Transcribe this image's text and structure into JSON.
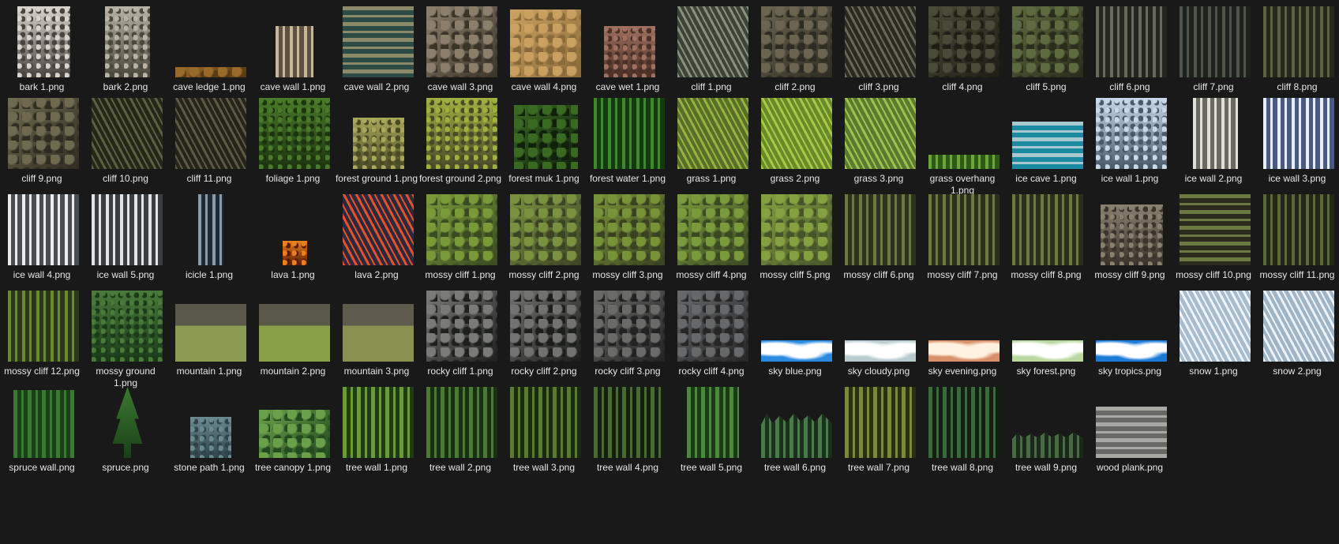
{
  "files": [
    {
      "name": "bark 1.png",
      "w": 0.74,
      "h": 1.0,
      "a": "#d9d4cc",
      "b": "#4a4440",
      "t": "speckle",
      "icon": "rock-texture-icon"
    },
    {
      "name": "bark 2.png",
      "w": 0.63,
      "h": 1.0,
      "a": "#b9b3a6",
      "b": "#4a473c",
      "t": "speckle",
      "icon": "rock-texture-icon"
    },
    {
      "name": "cave ledge 1.png",
      "w": 1.0,
      "h": 0.14,
      "a": "#9a6a2a",
      "b": "#5a3a14",
      "t": "noise",
      "icon": "ledge-texture-icon"
    },
    {
      "name": "cave wall 1.png",
      "w": 0.53,
      "h": 0.72,
      "a": "#c8b69a",
      "b": "#5e5040",
      "t": "vstripe",
      "icon": "rock-texture-icon"
    },
    {
      "name": "cave wall 2.png",
      "w": 1.0,
      "h": 1.0,
      "a": "#8a8a6a",
      "b": "#2c4a46",
      "t": "hstripe",
      "icon": "rock-texture-icon"
    },
    {
      "name": "cave wall 3.png",
      "w": 1.0,
      "h": 1.0,
      "a": "#8b7f6c",
      "b": "#3a3428",
      "t": "noise",
      "icon": "rock-texture-icon"
    },
    {
      "name": "cave wall 4.png",
      "w": 1.0,
      "h": 0.96,
      "a": "#c9a060",
      "b": "#8a6a3a",
      "t": "noise",
      "icon": "rock-texture-icon"
    },
    {
      "name": "cave wet 1.png",
      "w": 0.72,
      "h": 0.72,
      "a": "#a07060",
      "b": "#4a3026",
      "t": "speckle",
      "icon": "rock-texture-icon"
    },
    {
      "name": "cliff 1.png",
      "w": 1.0,
      "h": 1.0,
      "a": "#8a9080",
      "b": "#3c4438",
      "t": "diag",
      "icon": "cliff-texture-icon"
    },
    {
      "name": "cliff 2.png",
      "w": 1.0,
      "h": 1.0,
      "a": "#6a6450",
      "b": "#2e2c22",
      "t": "noise",
      "icon": "cliff-texture-icon"
    },
    {
      "name": "cliff 3.png",
      "w": 1.0,
      "h": 1.0,
      "a": "#6a6858",
      "b": "#2a2a22",
      "t": "diag",
      "icon": "cliff-texture-icon"
    },
    {
      "name": "cliff 4.png",
      "w": 1.0,
      "h": 1.0,
      "a": "#4a4a38",
      "b": "#1e1e16",
      "t": "noise",
      "icon": "cliff-texture-icon"
    },
    {
      "name": "cliff 5.png",
      "w": 1.0,
      "h": 1.0,
      "a": "#5e6a40",
      "b": "#2a2c1c",
      "t": "noise",
      "icon": "cliff-texture-icon"
    },
    {
      "name": "cliff 6.png",
      "w": 1.0,
      "h": 1.0,
      "a": "#6a6a5a",
      "b": "#262620",
      "t": "vstripe",
      "icon": "cliff-texture-icon"
    },
    {
      "name": "cliff 7.png",
      "w": 1.0,
      "h": 1.0,
      "a": "#4e5448",
      "b": "#1e221e",
      "t": "vstripe",
      "icon": "cliff-texture-icon"
    },
    {
      "name": "cliff 8.png",
      "w": 1.0,
      "h": 1.0,
      "a": "#5e6044",
      "b": "#26281c",
      "t": "vstripe",
      "icon": "cliff-texture-icon"
    },
    {
      "name": "cliff 9.png",
      "w": 1.0,
      "h": 1.0,
      "a": "#6e6a50",
      "b": "#302c22",
      "t": "noise",
      "icon": "cliff-texture-icon"
    },
    {
      "name": "cliff 10.png",
      "w": 1.0,
      "h": 1.0,
      "a": "#5a6040",
      "b": "#24261a",
      "t": "diag",
      "icon": "cliff-texture-icon"
    },
    {
      "name": "cliff 11.png",
      "w": 1.0,
      "h": 1.0,
      "a": "#5c5a44",
      "b": "#26241a",
      "t": "diag",
      "icon": "cliff-texture-icon"
    },
    {
      "name": "foliage 1.png",
      "w": 1.0,
      "h": 1.0,
      "a": "#4a7a2a",
      "b": "#1c3410",
      "t": "speckle",
      "icon": "foliage-texture-icon"
    },
    {
      "name": "forest ground 1.png",
      "w": 0.72,
      "h": 0.72,
      "a": "#a8a85a",
      "b": "#4a4a26",
      "t": "speckle",
      "icon": "ground-texture-icon"
    },
    {
      "name": "forest ground 2.png",
      "w": 1.0,
      "h": 1.0,
      "a": "#a0b040",
      "b": "#4a4a2a",
      "t": "speckle",
      "icon": "ground-texture-icon"
    },
    {
      "name": "forest muk 1.png",
      "w": 0.9,
      "h": 0.9,
      "a": "#3a6a22",
      "b": "#10200c",
      "t": "noise",
      "icon": "ground-texture-icon"
    },
    {
      "name": "forest water 1.png",
      "w": 1.0,
      "h": 1.0,
      "a": "#3e8a2a",
      "b": "#143a10",
      "t": "vstripe",
      "icon": "water-texture-icon"
    },
    {
      "name": "grass 1.png",
      "w": 1.0,
      "h": 1.0,
      "a": "#9ab040",
      "b": "#56702a",
      "t": "diag",
      "icon": "grass-texture-icon"
    },
    {
      "name": "grass 2.png",
      "w": 1.0,
      "h": 1.0,
      "a": "#a8c848",
      "b": "#6a8a2a",
      "t": "diag",
      "icon": "grass-texture-icon"
    },
    {
      "name": "grass 3.png",
      "w": 1.0,
      "h": 1.0,
      "a": "#a0c050",
      "b": "#5a7a30",
      "t": "diag",
      "icon": "grass-texture-icon"
    },
    {
      "name": "grass overhang 1.png",
      "w": 1.0,
      "h": 0.2,
      "a": "#6aa63a",
      "b": "#2e5a16",
      "t": "vstripe",
      "icon": "grass-texture-icon"
    },
    {
      "name": "ice cave 1.png",
      "w": 1.0,
      "h": 0.67,
      "a": "#a8c8d0",
      "b": "#1a8aa0",
      "t": "hstripe",
      "icon": "ice-texture-icon"
    },
    {
      "name": "ice wall 1.png",
      "w": 1.0,
      "h": 1.0,
      "a": "#c8d8e8",
      "b": "#4a5a68",
      "t": "speckle",
      "icon": "ice-texture-icon"
    },
    {
      "name": "ice wall 2.png",
      "w": 0.63,
      "h": 1.0,
      "a": "#e0e0d8",
      "b": "#6a6a60",
      "t": "vstripe",
      "icon": "ice-texture-icon"
    },
    {
      "name": "ice wall 3.png",
      "w": 1.0,
      "h": 1.0,
      "a": "#e8eef8",
      "b": "#4a5a80",
      "t": "vstripe",
      "icon": "ice-texture-icon"
    },
    {
      "name": "ice wall 4.png",
      "w": 1.0,
      "h": 1.0,
      "a": "#e8ecee",
      "b": "#4a4e50",
      "t": "vstripe",
      "icon": "ice-texture-icon"
    },
    {
      "name": "ice wall 5.png",
      "w": 1.0,
      "h": 1.0,
      "a": "#e0e4e6",
      "b": "#3a3e40",
      "t": "vstripe",
      "icon": "ice-texture-icon"
    },
    {
      "name": "icicle 1.png",
      "w": 0.36,
      "h": 1.0,
      "a": "#8a9aa8",
      "b": "#1e2a34",
      "t": "vstripe",
      "icon": "ice-texture-icon"
    },
    {
      "name": "lava 1.png",
      "w": 0.35,
      "h": 0.35,
      "a": "#e8801c",
      "b": "#5a1a08",
      "t": "speckle",
      "icon": "lava-texture-icon"
    },
    {
      "name": "lava 2.png",
      "w": 1.0,
      "h": 1.0,
      "a": "#e8502a",
      "b": "#2a2a3e",
      "t": "diag",
      "icon": "lava-texture-icon"
    },
    {
      "name": "mossy cliff 1.png",
      "w": 1.0,
      "h": 1.0,
      "a": "#7a9a3a",
      "b": "#3a4a22",
      "t": "noise",
      "icon": "moss-texture-icon"
    },
    {
      "name": "mossy cliff 2.png",
      "w": 1.0,
      "h": 1.0,
      "a": "#7a9240",
      "b": "#3c4426",
      "t": "noise",
      "icon": "moss-texture-icon"
    },
    {
      "name": "mossy cliff 3.png",
      "w": 1.0,
      "h": 1.0,
      "a": "#789238",
      "b": "#3a4222",
      "t": "noise",
      "icon": "moss-texture-icon"
    },
    {
      "name": "mossy cliff 4.png",
      "w": 1.0,
      "h": 1.0,
      "a": "#7a9a3c",
      "b": "#3a4824",
      "t": "noise",
      "icon": "moss-texture-icon"
    },
    {
      "name": "mossy cliff 5.png",
      "w": 1.0,
      "h": 1.0,
      "a": "#84a040",
      "b": "#46542a",
      "t": "noise",
      "icon": "moss-texture-icon"
    },
    {
      "name": "mossy cliff 6.png",
      "w": 1.0,
      "h": 1.0,
      "a": "#6a7a3a",
      "b": "#2e3020",
      "t": "vstripe",
      "icon": "moss-texture-icon"
    },
    {
      "name": "mossy cliff 7.png",
      "w": 1.0,
      "h": 1.0,
      "a": "#6a7a3a",
      "b": "#2c2e1e",
      "t": "vstripe",
      "icon": "moss-texture-icon"
    },
    {
      "name": "mossy cliff 8.png",
      "w": 1.0,
      "h": 1.0,
      "a": "#6a7a3a",
      "b": "#2c2e1e",
      "t": "vstripe",
      "icon": "moss-texture-icon"
    },
    {
      "name": "mossy cliff 9.png",
      "w": 0.88,
      "h": 0.86,
      "a": "#8a8070",
      "b": "#3a342c",
      "t": "speckle",
      "icon": "moss-texture-icon"
    },
    {
      "name": "mossy cliff 10.png",
      "w": 1.0,
      "h": 1.0,
      "a": "#6a7a40",
      "b": "#2a2a1e",
      "t": "hstripe",
      "icon": "moss-texture-icon"
    },
    {
      "name": "mossy cliff 11.png",
      "w": 1.0,
      "h": 1.0,
      "a": "#5a6a34",
      "b": "#24261a",
      "t": "vstripe",
      "icon": "moss-texture-icon"
    },
    {
      "name": "mossy cliff 12.png",
      "w": 1.0,
      "h": 1.0,
      "a": "#6a8a30",
      "b": "#2c3618",
      "t": "vstripe",
      "icon": "moss-texture-icon"
    },
    {
      "name": "mossy ground 1.png",
      "w": 1.0,
      "h": 1.0,
      "a": "#4a7a3a",
      "b": "#1a3a1a",
      "t": "speckle",
      "icon": "moss-texture-icon"
    },
    {
      "name": "mountain 1.png",
      "w": 1.0,
      "h": 0.92,
      "a": "#8a9a50",
      "b": "#5a5848",
      "t": "mtn",
      "icon": "mountain-texture-icon"
    },
    {
      "name": "mountain 2.png",
      "w": 1.0,
      "h": 0.92,
      "a": "#8aa048",
      "b": "#5a5848",
      "t": "mtn",
      "icon": "mountain-texture-icon"
    },
    {
      "name": "mountain 3.png",
      "w": 1.0,
      "h": 0.92,
      "a": "#8a9050",
      "b": "#5e5a4c",
      "t": "mtn",
      "icon": "mountain-texture-icon"
    },
    {
      "name": "rocky cliff 1.png",
      "w": 1.0,
      "h": 1.0,
      "a": "#7a7a76",
      "b": "#1e201e",
      "t": "noise",
      "icon": "rock-texture-icon"
    },
    {
      "name": "rocky cliff 2.png",
      "w": 1.0,
      "h": 1.0,
      "a": "#727270",
      "b": "#1c1e1c",
      "t": "noise",
      "icon": "rock-texture-icon"
    },
    {
      "name": "rocky cliff 3.png",
      "w": 1.0,
      "h": 1.0,
      "a": "#6a6a68",
      "b": "#222222",
      "t": "noise",
      "icon": "rock-texture-icon"
    },
    {
      "name": "rocky cliff 4.png",
      "w": 1.0,
      "h": 1.0,
      "a": "#66686a",
      "b": "#262626",
      "t": "noise",
      "icon": "rock-texture-icon"
    },
    {
      "name": "sky blue.png",
      "w": 1.0,
      "h": 0.3,
      "a": "#ffffff",
      "b": "#2a8ae0",
      "t": "cloud",
      "icon": "sky-texture-icon"
    },
    {
      "name": "sky cloudy.png",
      "w": 1.0,
      "h": 0.3,
      "a": "#ffffff",
      "b": "#b8ccd0",
      "t": "cloud",
      "icon": "sky-texture-icon"
    },
    {
      "name": "sky evening.png",
      "w": 1.0,
      "h": 0.3,
      "a": "#fff2e0",
      "b": "#d8906a",
      "t": "cloud",
      "icon": "sky-texture-icon"
    },
    {
      "name": "sky forest.png",
      "w": 1.0,
      "h": 0.3,
      "a": "#ffffff",
      "b": "#b8d8a0",
      "t": "cloud",
      "icon": "sky-texture-icon"
    },
    {
      "name": "sky tropics.png",
      "w": 1.0,
      "h": 0.3,
      "a": "#ffffff",
      "b": "#1a7ad8",
      "t": "cloud",
      "icon": "sky-texture-icon"
    },
    {
      "name": "snow 1.png",
      "w": 1.0,
      "h": 1.0,
      "a": "#f0f4f8",
      "b": "#a8bcd0",
      "t": "diag",
      "icon": "snow-texture-icon"
    },
    {
      "name": "snow 2.png",
      "w": 1.0,
      "h": 1.0,
      "a": "#eef2f6",
      "b": "#a0b4c8",
      "t": "diag",
      "icon": "snow-texture-icon"
    },
    {
      "name": "spruce wall.png",
      "w": 0.86,
      "h": 0.96,
      "a": "#3a7a30",
      "b": "#1a4018",
      "t": "trees",
      "icon": "tree-texture-icon"
    },
    {
      "name": "spruce.png",
      "w": 0.5,
      "h": 1.0,
      "a": "#3a7a30",
      "b": "#1a4018",
      "t": "tree1",
      "icon": "tree-texture-icon"
    },
    {
      "name": "stone path 1.png",
      "w": 0.58,
      "h": 0.58,
      "a": "#6a8a90",
      "b": "#2e4448",
      "t": "speckle",
      "icon": "stone-texture-icon"
    },
    {
      "name": "tree canopy 1.png",
      "w": 1.0,
      "h": 0.68,
      "a": "#6aa04a",
      "b": "#244a20",
      "t": "noise",
      "icon": "tree-texture-icon"
    },
    {
      "name": "tree wall 1.png",
      "w": 1.0,
      "h": 1.0,
      "a": "#6a9a3a",
      "b": "#1e3a16",
      "t": "trees",
      "icon": "tree-texture-icon"
    },
    {
      "name": "tree wall 2.png",
      "w": 1.0,
      "h": 1.0,
      "a": "#4a7a34",
      "b": "#1a3014",
      "t": "trees",
      "icon": "tree-texture-icon"
    },
    {
      "name": "tree wall 3.png",
      "w": 1.0,
      "h": 1.0,
      "a": "#5a7a30",
      "b": "#1a2a12",
      "t": "trees",
      "icon": "tree-texture-icon"
    },
    {
      "name": "tree wall 4.png",
      "w": 1.0,
      "h": 1.0,
      "a": "#4a6a34",
      "b": "#141e12",
      "t": "trees",
      "icon": "tree-texture-icon"
    },
    {
      "name": "tree wall 5.png",
      "w": 0.73,
      "h": 1.0,
      "a": "#4a8a3a",
      "b": "#1a3a18",
      "t": "trees",
      "icon": "tree-texture-icon"
    },
    {
      "name": "tree wall 6.png",
      "w": 1.0,
      "h": 0.62,
      "a": "#4a7a4a",
      "b": "#1a301c",
      "t": "trees",
      "icon": "tree-texture-icon"
    },
    {
      "name": "tree wall 7.png",
      "w": 1.0,
      "h": 1.0,
      "a": "#7a8a3a",
      "b": "#2a3014",
      "t": "trees",
      "icon": "tree-texture-icon"
    },
    {
      "name": "tree wall 8.png",
      "w": 1.0,
      "h": 1.0,
      "a": "#3a6a3a",
      "b": "#141e14",
      "t": "trees",
      "icon": "tree-texture-icon"
    },
    {
      "name": "tree wall 9.png",
      "w": 1.0,
      "h": 0.36,
      "a": "#4a6a44",
      "b": "#1a281a",
      "t": "trees",
      "icon": "tree-texture-icon"
    },
    {
      "name": "wood plank.png",
      "w": 1.0,
      "h": 0.72,
      "a": "#a8a8a4",
      "b": "#686864",
      "t": "hstripe",
      "icon": "wood-texture-icon"
    }
  ]
}
